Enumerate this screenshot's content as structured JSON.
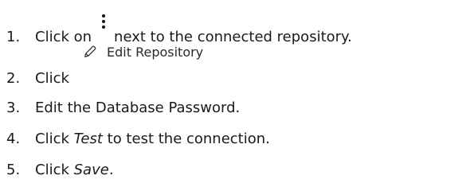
{
  "steps": [
    {
      "number": "1.",
      "before": "Click on",
      "after": "next to the connected repository."
    },
    {
      "number": "2.",
      "before": "Click",
      "chip_label": "Edit Repository"
    },
    {
      "number": "3.",
      "text": "Edit the Database Password."
    },
    {
      "number": "4.",
      "before": "Click",
      "em": "Test",
      "after": "to test the connection."
    },
    {
      "number": "5.",
      "before": "Click",
      "em": "Save",
      "after": "."
    }
  ],
  "icons": {
    "kebab": "more-vertical-icon",
    "pencil": "pencil-icon"
  }
}
